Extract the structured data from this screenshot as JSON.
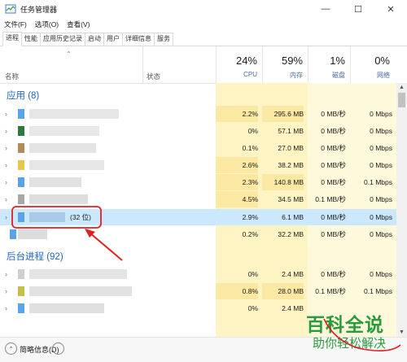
{
  "window": {
    "title": "任务管理器",
    "buttons": [
      "—",
      "☐",
      "✕"
    ]
  },
  "menu": [
    "文件(F)",
    "选项(O)",
    "查看(V)"
  ],
  "tabs": [
    {
      "label": "进程",
      "active": true
    },
    {
      "label": "性能",
      "active": false
    },
    {
      "label": "应用历史记录",
      "active": false
    },
    {
      "label": "启动",
      "active": false
    },
    {
      "label": "用户",
      "active": false
    },
    {
      "label": "详细信息",
      "active": false
    },
    {
      "label": "服务",
      "active": false
    }
  ],
  "header": {
    "name": "名称",
    "status": "状态",
    "cpu": {
      "pct": "24%",
      "label": "CPU"
    },
    "mem": {
      "pct": "59%",
      "label": "内存"
    },
    "disk": {
      "pct": "1%",
      "label": "磁盘"
    },
    "net": {
      "pct": "0%",
      "label": "网络"
    }
  },
  "apps_group": "应用 (8)",
  "bg_group": "后台进程 (92)",
  "rows": [
    {
      "cpu": "2.2%",
      "mem": "295.6 MB",
      "disk": "0 MB/秒",
      "net": "0 Mbps",
      "name": ""
    },
    {
      "cpu": "0%",
      "mem": "57.1 MB",
      "disk": "0 MB/秒",
      "net": "0 Mbps",
      "name": ""
    },
    {
      "cpu": "0.1%",
      "mem": "27.0 MB",
      "disk": "0 MB/秒",
      "net": "0 Mbps",
      "name": ""
    },
    {
      "cpu": "2.6%",
      "mem": "38.2 MB",
      "disk": "0 MB/秒",
      "net": "0 Mbps",
      "name": ""
    },
    {
      "cpu": "2.3%",
      "mem": "140.8 MB",
      "disk": "0 MB/秒",
      "net": "0.1 Mbps",
      "name": ""
    },
    {
      "cpu": "4.5%",
      "mem": "34.5 MB",
      "disk": "0.1 MB/秒",
      "net": "0 Mbps",
      "name": ""
    },
    {
      "cpu": "2.9%",
      "mem": "6.1 MB",
      "disk": "0 MB/秒",
      "net": "0 Mbps",
      "name": "(32 位)"
    },
    {
      "cpu": "0.2%",
      "mem": "32.2 MB",
      "disk": "0 MB/秒",
      "net": "0 Mbps",
      "name": ""
    },
    {
      "cpu": "0%",
      "mem": "2.4 MB",
      "disk": "0 MB/秒",
      "net": "0 Mbps",
      "name": ""
    },
    {
      "cpu": "0.8%",
      "mem": "28.0 MB",
      "disk": "0.1 MB/秒",
      "net": "0.1 Mbps",
      "name": ""
    },
    {
      "cpu": "0%",
      "mem": "2.4 MB",
      "disk": "",
      "net": "",
      "name": ""
    }
  ],
  "footer": {
    "label": "简略信息(D)",
    "toggle_icon": "chevron-up-icon"
  },
  "watermark": {
    "main": "百科全说",
    "sub": "助你轻松解决"
  },
  "colors": {
    "accent": "#1f66c6",
    "selected": "#cce8ff",
    "heat_light": "#fff4c4",
    "heat_mid": "#fbe8a3",
    "annotation": "#e02020"
  }
}
